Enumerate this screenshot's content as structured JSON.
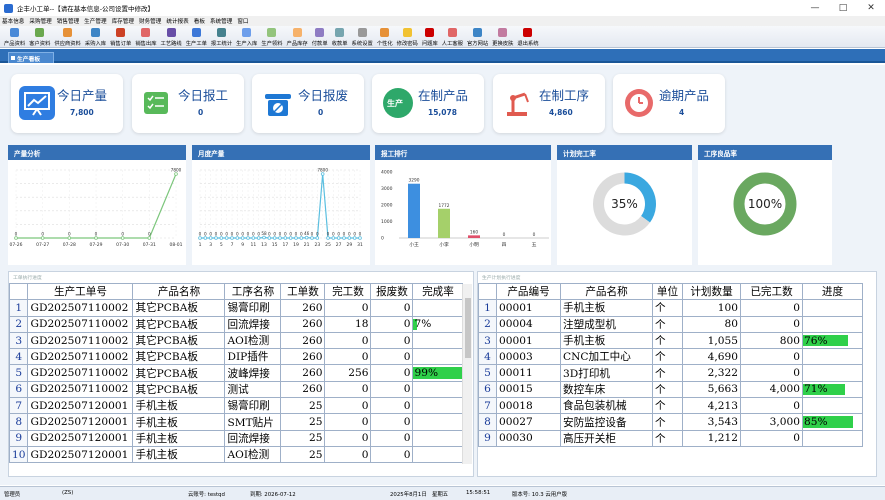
{
  "window": {
    "title": "企丰小工单--【请在基本信息-公司设置中修改】",
    "min": "—",
    "max": "□",
    "close": "✕"
  },
  "menu": [
    "基本信息",
    "采购管理",
    "销售管理",
    "生产管理",
    "库存管理",
    "财务管理",
    "统计报表",
    "看板",
    "系统管理",
    "窗口"
  ],
  "toolbar": [
    {
      "label": "产品资料",
      "color": "#4a8ad8"
    },
    {
      "label": "客户资料",
      "color": "#6aa84f"
    },
    {
      "label": "供应商资料",
      "color": "#e69138"
    },
    {
      "label": "采购入库",
      "color": "#3d85c6"
    },
    {
      "label": "销售订单",
      "color": "#cc4125"
    },
    {
      "label": "销售出库",
      "color": "#e06666"
    },
    {
      "label": "工艺路线",
      "color": "#674ea7"
    },
    {
      "label": "生产工单",
      "color": "#3c78d8"
    },
    {
      "label": "报工统计",
      "color": "#45818e"
    },
    {
      "label": "生产入库",
      "color": "#6d9eeb"
    },
    {
      "label": "生产领料",
      "color": "#93c47d"
    },
    {
      "label": "产品库存",
      "color": "#f6b26b"
    },
    {
      "label": "付款单",
      "color": "#8e7cc3"
    },
    {
      "label": "收款单",
      "color": "#76a5af"
    },
    {
      "label": "系统设置",
      "color": "#999999"
    },
    {
      "label": "个性化",
      "color": "#e69138"
    },
    {
      "label": "修改密码",
      "color": "#f1c232"
    },
    {
      "label": "问题库",
      "color": "#cc0000"
    },
    {
      "label": "人工客服",
      "color": "#e06666"
    },
    {
      "label": "官方网站",
      "color": "#3d85c6"
    },
    {
      "label": "更换皮肤",
      "color": "#c27ba0"
    },
    {
      "label": "退出系统",
      "color": "#cc0000"
    }
  ],
  "tab": "生产看板",
  "cards": [
    {
      "label": "今日产量",
      "value": "7,800",
      "color": "#2f7de1"
    },
    {
      "label": "今日报工",
      "value": "0",
      "color": "#58b95a"
    },
    {
      "label": "今日报废",
      "value": "0",
      "color": "#1e78d4"
    },
    {
      "label": "在制产品",
      "value": "15,078",
      "color": "#2ea86a",
      "badge": "生产"
    },
    {
      "label": "在制工序",
      "value": "4,860",
      "color": "#e05a4f"
    },
    {
      "label": "逾期产品",
      "value": "4",
      "color": "#e86a6a"
    }
  ],
  "panels": {
    "p1": "产量分析",
    "p2": "月度产量",
    "p3": "报工排行",
    "p4": "计划完工率",
    "p5": "工序良品率"
  },
  "chart_data": [
    {
      "type": "line",
      "title": "产量分析",
      "categories": [
        "07-26",
        "07-27",
        "07-28",
        "07-29",
        "07-30",
        "07-31",
        "08-01"
      ],
      "values": [
        0,
        0,
        0,
        0,
        0,
        0,
        7800
      ],
      "line_color": "#7cc67c"
    },
    {
      "type": "line",
      "title": "月度产量",
      "categories": [
        "1",
        "2",
        "3",
        "4",
        "5",
        "6",
        "7",
        "8",
        "9",
        "10",
        "11",
        "12",
        "13",
        "14",
        "15",
        "16",
        "17",
        "18",
        "19",
        "20",
        "21",
        "22",
        "23",
        "24",
        "25",
        "26",
        "27",
        "28",
        "29",
        "30",
        "31"
      ],
      "values": [
        0,
        0,
        0,
        0,
        0,
        0,
        0,
        0,
        0,
        0,
        0,
        0,
        58,
        0,
        0,
        0,
        0,
        0,
        0,
        0,
        46,
        0,
        0,
        7800,
        0,
        0,
        0,
        0,
        0,
        0,
        0
      ],
      "line_color": "#5bbfe0"
    },
    {
      "type": "bar",
      "title": "报工排行",
      "categories": [
        "小王",
        "小李",
        "小明",
        "四",
        "五"
      ],
      "values": [
        3290,
        1772,
        160,
        0,
        0
      ],
      "colors": [
        "#3d8fe0",
        "#a5d06a",
        "#e0506a",
        "#aaaaaa",
        "#aaaaaa"
      ],
      "yticks": [
        "4000",
        "3000",
        "2000",
        "1000",
        "0"
      ]
    },
    {
      "type": "pie",
      "title": "计划完工率",
      "values": [
        35,
        65
      ],
      "label": "35%",
      "colors": [
        "#3aa8e0",
        "#dcdcdc"
      ]
    },
    {
      "type": "pie",
      "title": "工序良品率",
      "values": [
        100
      ],
      "label": "100%",
      "colors": [
        "#6aa860"
      ]
    }
  ],
  "left_grid": {
    "caption": "工单执行进度",
    "columns": [
      "",
      "生产工单号",
      "产品名称",
      "工序名称",
      "工单数",
      "完工数",
      "报废数",
      "完成率"
    ],
    "rows": [
      [
        "1",
        "GD202507110002",
        "其它PCBA板",
        "锡膏印刷",
        "260",
        "0",
        "0",
        ""
      ],
      [
        "2",
        "GD202507110002",
        "其它PCBA板",
        "回流焊接",
        "260",
        "18",
        "0",
        "7%"
      ],
      [
        "3",
        "GD202507110002",
        "其它PCBA板",
        "AOI检测",
        "260",
        "0",
        "0",
        ""
      ],
      [
        "4",
        "GD202507110002",
        "其它PCBA板",
        "DIP插件",
        "260",
        "0",
        "0",
        ""
      ],
      [
        "5",
        "GD202507110002",
        "其它PCBA板",
        "波峰焊接",
        "260",
        "256",
        "0",
        "99%"
      ],
      [
        "6",
        "GD202507110002",
        "其它PCBA板",
        "测试",
        "260",
        "0",
        "0",
        ""
      ],
      [
        "7",
        "GD202507120001",
        "手机主板",
        "锡膏印刷",
        "25",
        "0",
        "0",
        ""
      ],
      [
        "8",
        "GD202507120001",
        "手机主板",
        "SMT贴片",
        "25",
        "0",
        "0",
        ""
      ],
      [
        "9",
        "GD202507120001",
        "手机主板",
        "回流焊接",
        "25",
        "0",
        "0",
        ""
      ],
      [
        "10",
        "GD202507120001",
        "手机主板",
        "AOI检测",
        "25",
        "0",
        "0",
        ""
      ]
    ],
    "progress": [
      0,
      0.07,
      0,
      0,
      0.99,
      0,
      0,
      0,
      0,
      0
    ]
  },
  "right_grid": {
    "caption": "生产计划执行进度",
    "columns": [
      "",
      "产品编号",
      "产品名称",
      "单位",
      "计划数量",
      "已完工数",
      "进度"
    ],
    "rows": [
      [
        "1",
        "00001",
        "手机主板",
        "个",
        "100",
        "0",
        ""
      ],
      [
        "2",
        "00004",
        "注塑成型机",
        "个",
        "80",
        "0",
        ""
      ],
      [
        "3",
        "00001",
        "手机主板",
        "个",
        "1,055",
        "800",
        "76%"
      ],
      [
        "4",
        "00003",
        "CNC加工中心",
        "个",
        "4,690",
        "0",
        ""
      ],
      [
        "5",
        "00011",
        "3D打印机",
        "个",
        "2,322",
        "0",
        ""
      ],
      [
        "6",
        "00015",
        "数控车床",
        "个",
        "5,663",
        "4,000",
        "71%"
      ],
      [
        "7",
        "00018",
        "食品包装机械",
        "个",
        "4,213",
        "0",
        ""
      ],
      [
        "8",
        "00027",
        "安防监控设备",
        "个",
        "3,543",
        "3,000",
        "85%"
      ],
      [
        "9",
        "00030",
        "高压开关柜",
        "个",
        "1,212",
        "0",
        ""
      ]
    ],
    "progress": [
      0,
      0,
      0.76,
      0,
      0,
      0.71,
      0,
      0.85,
      0
    ]
  },
  "status": {
    "s1": "管理员",
    "s2": "(ZS)",
    "s3": "云账号: testqd",
    "s4": "到期: 2026-07-12",
    "s5": "2025年8月1日",
    "s6": "星期五",
    "s7": "15:58:51",
    "s8": "版本号: 10.3 云用户版"
  }
}
